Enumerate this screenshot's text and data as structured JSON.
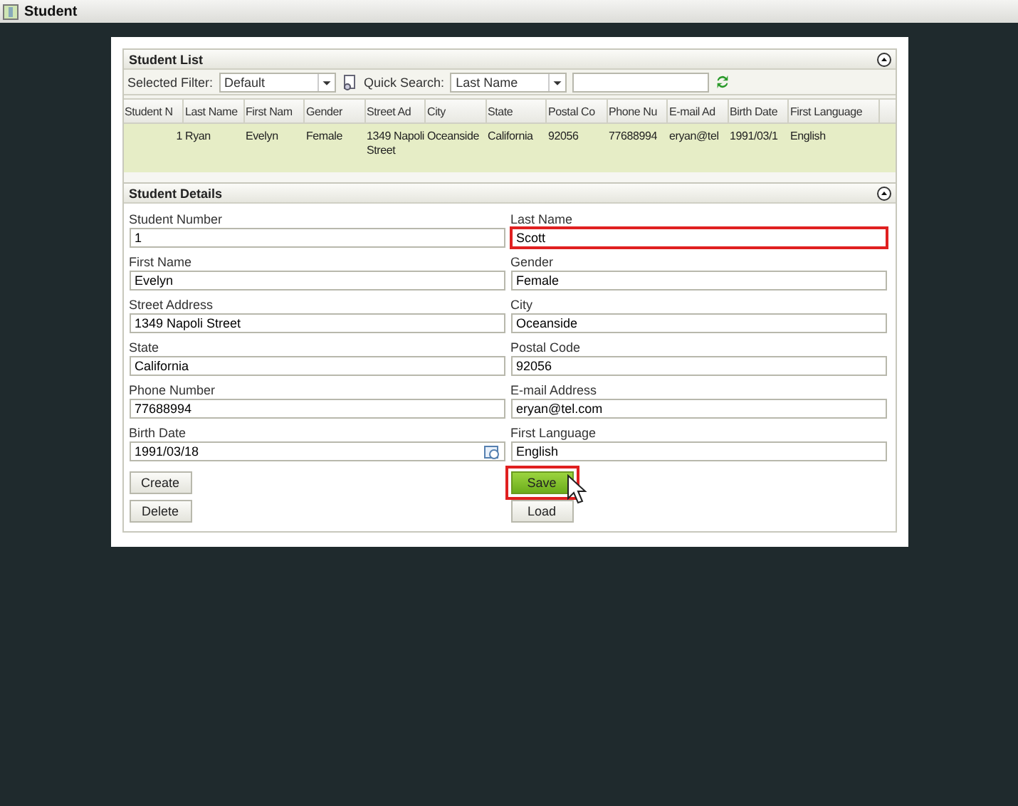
{
  "window": {
    "title": "Student"
  },
  "student_list": {
    "title": "Student List",
    "filter_label": "Selected Filter:",
    "filter_value": "Default",
    "quick_search_label": "Quick Search:",
    "quick_search_value": "Last Name",
    "columns": [
      "Student N",
      "Last Name",
      "First Nam",
      "Gender",
      "Street Ad",
      "City",
      "State",
      "Postal Co",
      "Phone Nu",
      "E-mail Ad",
      "Birth Date",
      "First Language"
    ],
    "rows": [
      {
        "selected": true,
        "cells": [
          "1",
          "Ryan",
          "Evelyn",
          "Female",
          "1349 Napoli Street",
          "Oceanside",
          "California",
          "92056",
          "77688994",
          "eryan@tel",
          "1991/03/1",
          "English"
        ]
      }
    ]
  },
  "student_details": {
    "title": "Student Details",
    "fields": [
      {
        "label": "Student Number",
        "value": "1",
        "kind": "text",
        "focused": false,
        "highlighted": false
      },
      {
        "label": "Last Name",
        "value": "Scott",
        "kind": "text",
        "focused": true,
        "highlighted": true
      },
      {
        "label": "First Name",
        "value": "Evelyn",
        "kind": "text",
        "focused": false,
        "highlighted": false
      },
      {
        "label": "Gender",
        "value": "Female",
        "kind": "text",
        "focused": false,
        "highlighted": false
      },
      {
        "label": "Street Address",
        "value": "1349 Napoli Street",
        "kind": "text",
        "focused": false,
        "highlighted": false
      },
      {
        "label": "City",
        "value": "Oceanside",
        "kind": "text",
        "focused": false,
        "highlighted": false
      },
      {
        "label": "State",
        "value": "California",
        "kind": "text",
        "focused": false,
        "highlighted": false
      },
      {
        "label": "Postal Code",
        "value": "92056",
        "kind": "text",
        "focused": false,
        "highlighted": false
      },
      {
        "label": "Phone Number",
        "value": "77688994",
        "kind": "text",
        "focused": false,
        "highlighted": false
      },
      {
        "label": "E-mail Address",
        "value": "eryan@tel.com",
        "kind": "text",
        "focused": false,
        "highlighted": false
      },
      {
        "label": "Birth Date",
        "value": "1991/03/18",
        "kind": "date",
        "focused": false,
        "highlighted": false
      },
      {
        "label": "First Language",
        "value": "English",
        "kind": "text",
        "focused": false,
        "highlighted": false
      }
    ],
    "buttons": [
      {
        "label": "Create",
        "kind": "normal",
        "highlighted": false
      },
      {
        "label": "Save",
        "kind": "primary",
        "highlighted": true
      },
      {
        "label": "Delete",
        "kind": "normal",
        "highlighted": false
      },
      {
        "label": "Load",
        "kind": "normal",
        "highlighted": false
      }
    ]
  }
}
